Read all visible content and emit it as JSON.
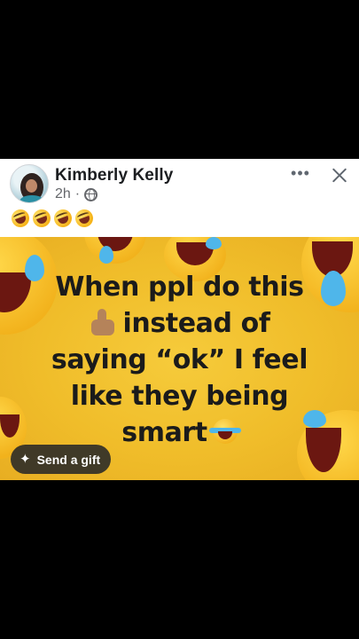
{
  "post": {
    "author": "Kimberly Kelly",
    "time": "2h",
    "separator": "·",
    "privacy_icon": "globe-icon",
    "more_icon": "more-options-icon",
    "more_label": "•••",
    "close_icon": "close-icon",
    "caption_emojis": [
      "rolling-on-floor-laughing",
      "rolling-on-floor-laughing",
      "rolling-on-floor-laughing",
      "rolling-on-floor-laughing"
    ]
  },
  "meme": {
    "line1": "When ppl do this",
    "line2_icon": "thumbs-up-icon",
    "line2": "instead of",
    "line3": "saying “ok” I feel",
    "line4": "like they being",
    "line5": "smart",
    "line5_icon": "tears-of-joy-icon"
  },
  "gift": {
    "label": "Send a gift",
    "icon": "sparkle-icon"
  },
  "colors": {
    "background": "#000000",
    "card": "#ffffff",
    "meme_yellow": "#f0bd2a",
    "meta_gray": "#65676b"
  }
}
